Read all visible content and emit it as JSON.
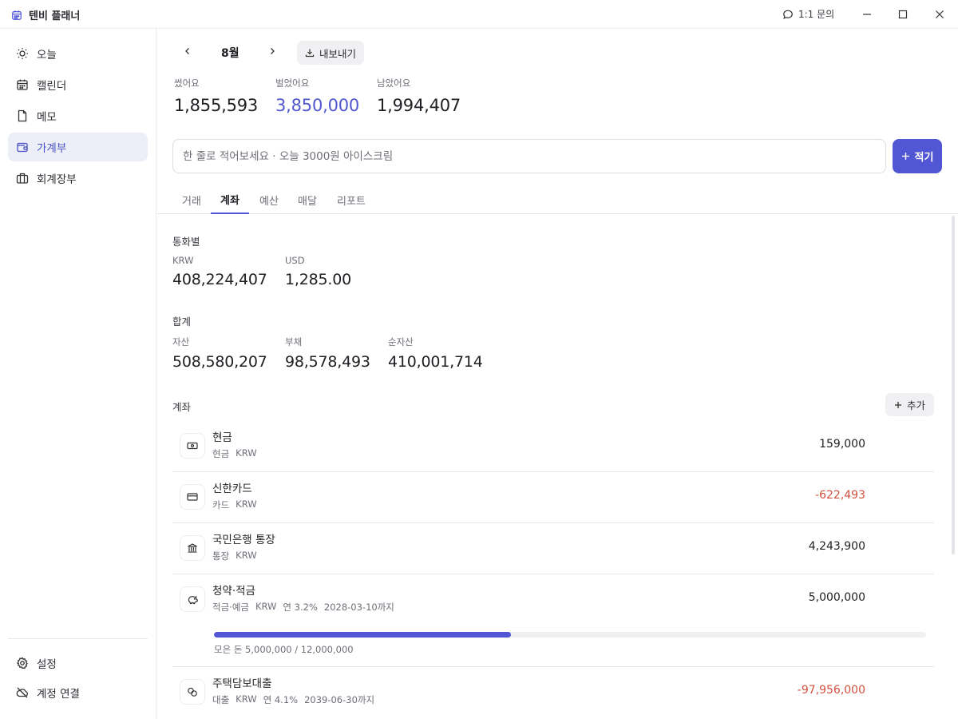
{
  "app": {
    "title": "텐비 플래너",
    "support_label": "1:1 문의"
  },
  "sidebar": {
    "items": [
      {
        "label": "오늘",
        "icon": "sun-icon"
      },
      {
        "label": "캘린더",
        "icon": "calendar-icon"
      },
      {
        "label": "메모",
        "icon": "file-icon"
      },
      {
        "label": "가계부",
        "icon": "wallet-icon",
        "active": true
      },
      {
        "label": "회계장부",
        "icon": "briefcase-icon"
      }
    ],
    "bottom": [
      {
        "label": "설정",
        "icon": "gear-icon"
      },
      {
        "label": "계정 연결",
        "icon": "cloud-off-icon"
      }
    ]
  },
  "header": {
    "month": "8월",
    "export_label": "내보내기",
    "stats": [
      {
        "label": "썼어요",
        "value": "1,855,593"
      },
      {
        "label": "벌었어요",
        "value": "3,850,000"
      },
      {
        "label": "남았어요",
        "value": "1,994,407"
      }
    ]
  },
  "quick_entry": {
    "placeholder": "한 줄로 적어보세요 · 오늘 3000원 아이스크림",
    "button_label": "적기"
  },
  "tabs": [
    "거래",
    "계좌",
    "예산",
    "매달",
    "리포트"
  ],
  "active_tab": "계좌",
  "by_currency": {
    "title": "통화별",
    "items": [
      {
        "label": "KRW",
        "value": "408,224,407"
      },
      {
        "label": "USD",
        "value": "1,285.00"
      }
    ]
  },
  "totals": {
    "title": "합계",
    "items": [
      {
        "label": "자산",
        "value": "508,580,207"
      },
      {
        "label": "부채",
        "value": "98,578,493"
      },
      {
        "label": "순자산",
        "value": "410,001,714"
      }
    ]
  },
  "accounts": {
    "title": "계좌",
    "add_label": "추가",
    "items": [
      {
        "name": "현금",
        "meta": [
          "현금",
          "KRW"
        ],
        "amount": "159,000",
        "negative": false,
        "icon": "cash-icon"
      },
      {
        "name": "신한카드",
        "meta": [
          "카드",
          "KRW"
        ],
        "amount": "-622,493",
        "negative": true,
        "icon": "card-icon"
      },
      {
        "name": "국민은행 통장",
        "meta": [
          "통장",
          "KRW"
        ],
        "amount": "4,243,900",
        "negative": false,
        "icon": "bank-icon"
      },
      {
        "name": "청약·적금",
        "meta": [
          "적금·예금",
          "KRW",
          "연 3.2%",
          "2028-03-10까지"
        ],
        "amount": "5,000,000",
        "negative": false,
        "icon": "piggy-bank-icon",
        "progress": 0.4167,
        "progress_label": "모은 돈 5,000,000 / 12,000,000"
      },
      {
        "name": "주택담보대출",
        "meta": [
          "대출",
          "KRW",
          "연 4.1%",
          "2039-06-30까지"
        ],
        "amount": "-97,956,000",
        "negative": true,
        "icon": "coins-icon"
      }
    ]
  }
}
